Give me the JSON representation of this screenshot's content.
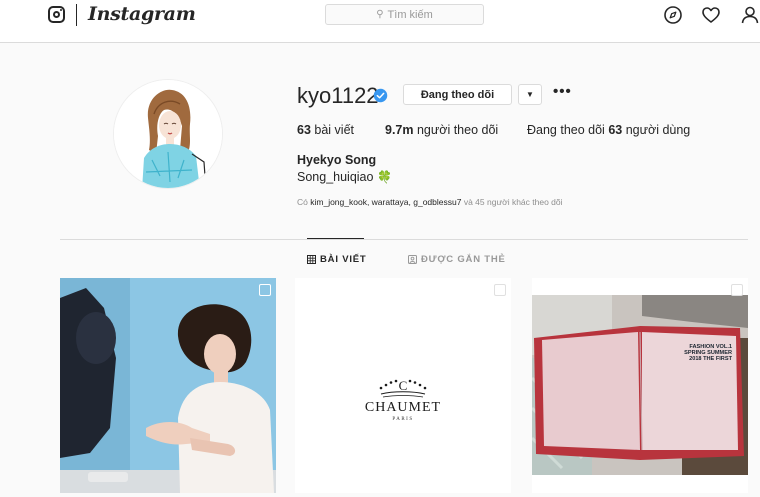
{
  "nav": {
    "brand": "Instagram",
    "search_placeholder": "Tìm kiếm",
    "icons": [
      "instagram-glyph-icon",
      "compass-icon",
      "heart-icon",
      "user-icon"
    ]
  },
  "profile": {
    "username": "kyo1122",
    "verified": true,
    "follow_label": "Đang theo dõi",
    "more_label": "•••",
    "posts_count": "63",
    "posts_label": "bài viết",
    "followers_count": "9.7m",
    "followers_label": "người theo dõi",
    "following_prefix": "Đang theo dõi",
    "following_count": "63",
    "following_suffix": "người dùng",
    "full_name": "Hyekyo Song",
    "bio": "Song_huiqiao",
    "bio_emoji": "🍀",
    "followed_by_prefix": "Có",
    "followed_by_names": "kim_jong_kook, warattaya, g_odblessu7",
    "followed_by_suffix": "và 45 người khác theo dõi"
  },
  "tabs": {
    "posts": "BÀI VIẾT",
    "tagged": "ĐƯỢC GẮN THẺ"
  },
  "posts": [
    {
      "kind": "photo",
      "multi": true
    },
    {
      "kind": "logo",
      "brand": "CHAUMET",
      "city": "PARIS",
      "multi": true
    },
    {
      "kind": "photo",
      "book_text": "FASHION Vol.1 SPRING SUMMER 2018 THE FIRST",
      "multi": true
    }
  ],
  "colors": {
    "verified_blue": "#3897f0",
    "border": "#dbdbdb",
    "text": "#262626",
    "muted": "#8e8e8e"
  }
}
